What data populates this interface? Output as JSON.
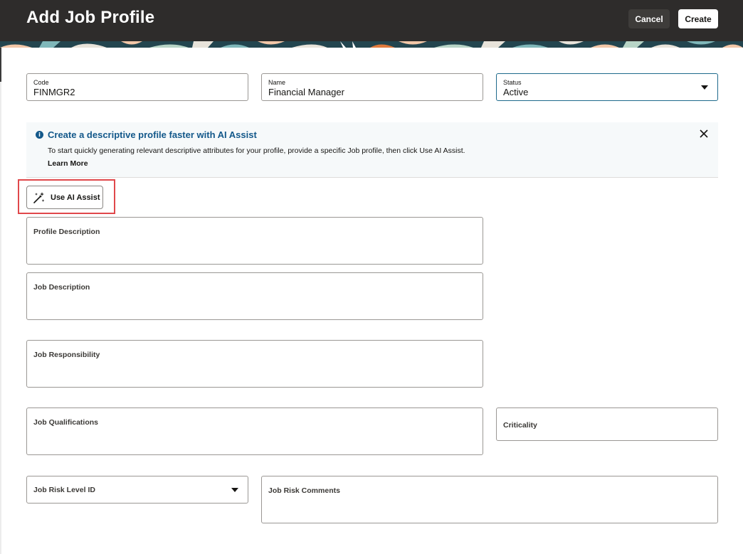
{
  "header": {
    "title": "Add Job Profile",
    "cancel_label": "Cancel",
    "create_label": "Create"
  },
  "fields": {
    "code": {
      "label": "Code",
      "value": "FINMGR2"
    },
    "name": {
      "label": "Name",
      "value": "Financial Manager"
    },
    "status": {
      "label": "Status",
      "value": "Active"
    }
  },
  "info_panel": {
    "title": "Create a descriptive profile faster with AI Assist",
    "text": "To start quickly generating relevant descriptive attributes for your profile, provide a specific Job profile, then click Use AI Assist.",
    "link": "Learn More"
  },
  "ai_assist": {
    "label": "Use AI Assist"
  },
  "descriptions": {
    "profile_description": "Profile Description",
    "job_description": "Job Description",
    "job_responsibility": "Job Responsibility",
    "job_qualifications": "Job Qualifications",
    "criticality": "Criticality",
    "job_risk_level_id": "Job Risk Level ID",
    "job_risk_comments": "Job Risk Comments"
  },
  "colors": {
    "header_bg": "#2e2c2b",
    "accent": "#13588a",
    "highlight": "#e0484b"
  }
}
